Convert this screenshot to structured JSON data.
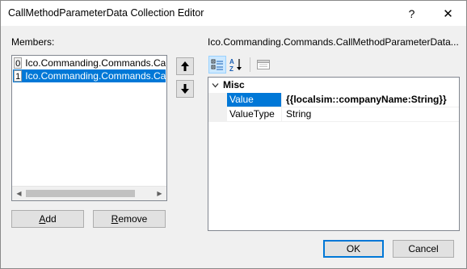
{
  "window": {
    "title": "CallMethodParameterData Collection Editor",
    "help_glyph": "?",
    "close_glyph": "✕"
  },
  "members": {
    "label": "Members:",
    "items": [
      {
        "index": "0",
        "text": "Ico.Commanding.Commands.CallM",
        "selected": false
      },
      {
        "index": "1",
        "text": "Ico.Commanding.Commands.CallM",
        "selected": true
      }
    ],
    "move_up_icon": "up-arrow-icon",
    "move_down_icon": "down-arrow-icon"
  },
  "buttons": {
    "add_accel": "A",
    "add_rest": "dd",
    "remove_accel": "R",
    "remove_rest": "emove",
    "ok": "OK",
    "cancel": "Cancel"
  },
  "properties": {
    "label": "Ico.Commanding.Commands.CallMethodParameterData...",
    "category": "Misc",
    "rows": [
      {
        "name": "Value",
        "value": "{{localsim::companyName:String}}",
        "selected": true
      },
      {
        "name": "ValueType",
        "value": "String",
        "selected": false
      }
    ]
  },
  "colors": {
    "selection": "#0078d7",
    "dialog_background": "#f0f0f0"
  }
}
